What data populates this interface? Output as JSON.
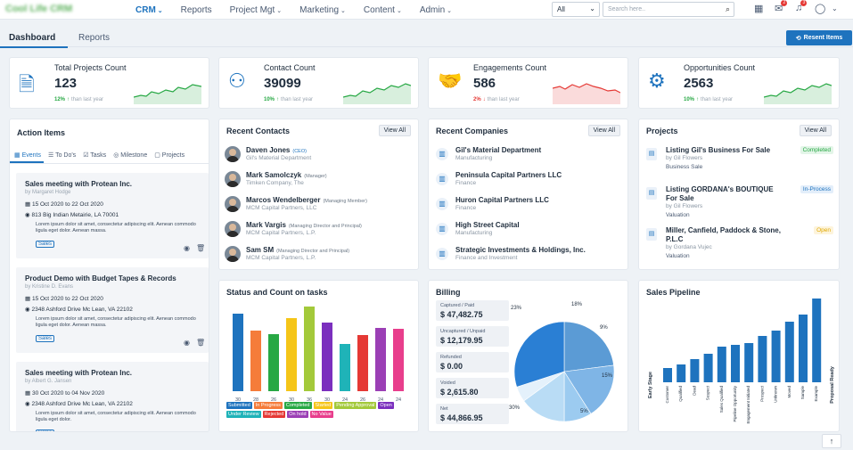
{
  "app": {
    "logo": "Cool Life CRM"
  },
  "nav": [
    {
      "label": "CRM",
      "caret": true,
      "active": true
    },
    {
      "label": "Reports",
      "caret": false
    },
    {
      "label": "Project Mgt",
      "caret": true
    },
    {
      "label": "Marketing",
      "caret": true
    },
    {
      "label": "Content",
      "caret": true
    },
    {
      "label": "Admin",
      "caret": true
    }
  ],
  "search": {
    "scope": "All",
    "placeholder": "Search here.."
  },
  "badges": {
    "mail": "2",
    "bell": "3"
  },
  "tabs": {
    "dashboard": "Dashboard",
    "reports": "Reports"
  },
  "resent": "Resent Items",
  "kpis": [
    {
      "title": "Total Projects Count",
      "value": "123",
      "pct": "12%",
      "arrow": "↑",
      "dir": "up",
      "note": "than last year",
      "color": "#27a844",
      "icon": "document-icon"
    },
    {
      "title": "Contact Count",
      "value": "39099",
      "pct": "10%",
      "arrow": "↑",
      "dir": "up",
      "note": "than last year",
      "color": "#27a844",
      "icon": "team-icon"
    },
    {
      "title": "Engagements Count",
      "value": "586",
      "pct": "2%",
      "arrow": "↓",
      "dir": "down",
      "note": "than last year",
      "color": "#e53935",
      "icon": "handshake-icon"
    },
    {
      "title": "Opportunities Count",
      "value": "2563",
      "pct": "10%",
      "arrow": "↑",
      "dir": "up",
      "note": "than last year",
      "color": "#27a844",
      "icon": "growth-icon"
    }
  ],
  "action_items": {
    "title": "Action Items",
    "tabs": [
      "Events",
      "To Do's",
      "Tasks",
      "Milestone",
      "Projects"
    ],
    "events": [
      {
        "title": "Sales meeting with Protean Inc.",
        "by": "by Margaret Hodge",
        "date": "15 Oct 2020 to 22 Oct 2020",
        "addr": "813 Big Indian Metairie, LA 70001",
        "desc": "Lorem ipsum dolor sit amet, consectetur adipiscing elit. Aenean commodo ligula eget dolor. Aenean massa.",
        "tag": "Sales"
      },
      {
        "title": "Product Demo with Budget Tapes & Records",
        "by": "by Kristine D. Evans",
        "date": "15 Oct 2020 to 22 Oct 2020",
        "addr": "2348 Ashford Drive Mc Lean, VA 22102",
        "desc": "Lorem ipsum dolor sit amet, consectetur adipiscing elit. Aenean commodo ligula eget dolor. Aenean massa.",
        "tag": "Sales"
      },
      {
        "title": "Sales meeting with Protean Inc.",
        "by": "by Albert G. Jansen",
        "date": "30 Oct 2020 to 04 Nov 2020",
        "addr": "2348 Ashford Drive Mc Lean, VA 22102",
        "desc": "Lorem ipsum dolor sit amet, consectetur adipiscing elit. Aenean commodo ligula eget dolor.",
        "tag": "Sales"
      }
    ]
  },
  "recent_contacts": {
    "title": "Recent Contacts",
    "view_all": "View All",
    "items": [
      {
        "name": "Daven Jones",
        "role": "(CEO)",
        "company": "Gil's Material Department"
      },
      {
        "name": "Mark Samolczyk",
        "role": "(Manager)",
        "company": "Timken Company, The"
      },
      {
        "name": "Marcos Wendelberger",
        "role": "(Managing Member)",
        "company": "MCM Capital Partners, LLC"
      },
      {
        "name": "Mark Vargis",
        "role": "(Managing Director and Principal)",
        "company": "MCM Capital Partners, L.P."
      },
      {
        "name": "Sam SM",
        "role": "(Managing Director and Principal)",
        "company": "MCM Capital Partners, L.P."
      }
    ]
  },
  "recent_companies": {
    "title": "Recent Companies",
    "view_all": "View All",
    "items": [
      {
        "name": "Gil's Material Department",
        "sector": "Manufacturing"
      },
      {
        "name": "Peninsula Capital Partners LLC",
        "sector": "Finance"
      },
      {
        "name": "Huron Capital Partners LLC",
        "sector": "Finance"
      },
      {
        "name": "High Street Capital",
        "sector": "Manufacturing"
      },
      {
        "name": "Strategic Investments & Holdings, Inc.",
        "sector": "Finance and Investment"
      }
    ]
  },
  "projects": {
    "title": "Projects",
    "view_all": "View All",
    "items": [
      {
        "name1": "Listing Gil's Business For Sale",
        "name2": "",
        "by": "by Gil Flowers",
        "type": "Business Sale",
        "status": "Completed",
        "color": "#27a844",
        "bg": "#e3f5e8"
      },
      {
        "name1": "Listing GORDANA's BOUTIQUE",
        "name2": "For Sale",
        "by": "by Gil Flowers",
        "type": "Valuation",
        "status": "In-Process",
        "color": "#1e73be",
        "bg": "#e3eefa"
      },
      {
        "name1": "Miller, Canfield, Paddock & Stone,",
        "name2": "P.L.C",
        "by": "by Gordana Vujec",
        "type": "Valuation",
        "status": "Open",
        "color": "#e0a800",
        "bg": "#fdf4dc"
      }
    ]
  },
  "status_chart": {
    "title": "Status and Count on tasks",
    "chart_data": {
      "type": "bar",
      "categories": [
        "Submitted",
        "In Progress",
        "Completed",
        "Started",
        "Pending Approval",
        "Open",
        "Under Review",
        "Rejected",
        "On hold",
        "No Value"
      ],
      "values": [
        30,
        28,
        26,
        30,
        36,
        30,
        24,
        26,
        24,
        24
      ],
      "colors": [
        "#1e73be",
        "#f57c3a",
        "#27a844",
        "#f5c518",
        "#a3c93a",
        "#7b2fbe",
        "#1fb3b8",
        "#e53935",
        "#9b3fb5",
        "#e83e8c"
      ],
      "ylim": [
        0,
        100
      ],
      "tick_labels": [
        "30",
        "28",
        "26",
        "30",
        "36",
        "30",
        "24",
        "26",
        "24",
        "24"
      ],
      "series_height_pct": [
        92,
        72,
        67,
        86,
        100,
        81,
        56,
        66,
        75,
        74
      ]
    }
  },
  "billing": {
    "title": "Billing",
    "items": [
      {
        "label": "Captured / Paid",
        "value": "$ 47,482.75"
      },
      {
        "label": "Uncaptured / Unpaid",
        "value": "$ 12,179.95"
      },
      {
        "label": "Refunded",
        "value": "$ 0.00"
      },
      {
        "label": "Voided",
        "value": "$ 2,615.80"
      },
      {
        "label": "Net",
        "value": "$ 44,866.95"
      }
    ],
    "chart_data": {
      "type": "pie",
      "labels": [
        "23%",
        "18%",
        "9%",
        "15%",
        "5%",
        "30%"
      ],
      "values": [
        23,
        18,
        9,
        15,
        5,
        30
      ],
      "colors": [
        "#5b9bd5",
        "#7fb5e6",
        "#9ccbf0",
        "#b9dcf5",
        "#e4f1fb",
        "#2a7fd4"
      ]
    }
  },
  "sales_pipeline": {
    "title": "Sales Pipeline",
    "chart_data": {
      "type": "bar",
      "categories": [
        "Customer",
        "Qualified",
        "Dead",
        "Suspect",
        "Sales Qualified",
        "Pipeline Opportunity",
        "Engagement Initiated",
        "Prospect",
        "Unknown",
        "Moved",
        "Sample",
        "Example"
      ],
      "values": [
        8,
        10,
        13,
        16,
        20,
        21,
        22,
        26,
        29,
        34,
        38,
        50
      ],
      "ylim": [
        0,
        50
      ],
      "xlabel_left": "Early Stage",
      "xlabel_right": "Proposal Ready"
    }
  }
}
